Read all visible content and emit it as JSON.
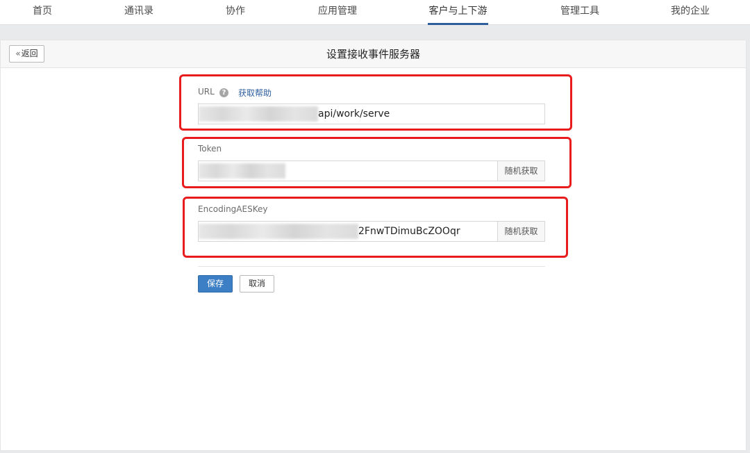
{
  "nav": {
    "items": [
      {
        "label": "首页"
      },
      {
        "label": "通讯录"
      },
      {
        "label": "协作"
      },
      {
        "label": "应用管理"
      },
      {
        "label": "客户与上下游"
      },
      {
        "label": "管理工具"
      },
      {
        "label": "我的企业"
      }
    ],
    "active_index": 4
  },
  "header": {
    "back_label": "返回",
    "title": "设置接收事件服务器"
  },
  "form": {
    "url": {
      "label": "URL",
      "help_icon": "?",
      "help_link": "获取帮助",
      "visible_value": "api/work/serve"
    },
    "token": {
      "label": "Token",
      "random_button": "随机获取"
    },
    "aes_key": {
      "label": "EncodingAESKey",
      "visible_value": "2FnwTDimuBcZOOqr",
      "random_button": "随机获取"
    }
  },
  "actions": {
    "save_label": "保存",
    "cancel_label": "取消"
  },
  "colors": {
    "accent": "#2e5e9c",
    "primary_button": "#3c7fc4",
    "highlight_box": "#e81c1c"
  }
}
